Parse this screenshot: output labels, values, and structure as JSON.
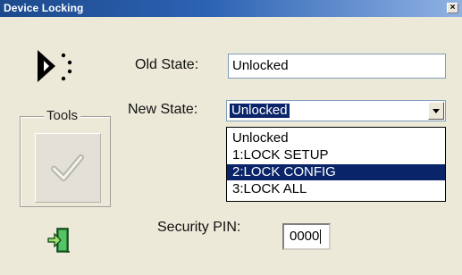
{
  "window": {
    "title": "Device Locking",
    "close_glyph": "×"
  },
  "logo": {
    "icon": "brand-logo-icon"
  },
  "old_state": {
    "label": "Old State:",
    "value": "Unlocked"
  },
  "new_state": {
    "label": "New State:",
    "selected": "Unlocked",
    "options": [
      "Unlocked",
      "1:LOCK SETUP",
      "2:LOCK CONFIG",
      "3:LOCK ALL"
    ],
    "highlighted_option": "2:LOCK CONFIG"
  },
  "tools": {
    "label": "Tools",
    "icon": "checkmark-icon"
  },
  "exit": {
    "icon": "exit-door-icon"
  },
  "security_pin": {
    "label": "Security PIN:",
    "value": "0000"
  },
  "colors": {
    "titlebar_start": "#1c4a8c",
    "selection": "#0a246a",
    "background": "#ece9d8"
  }
}
